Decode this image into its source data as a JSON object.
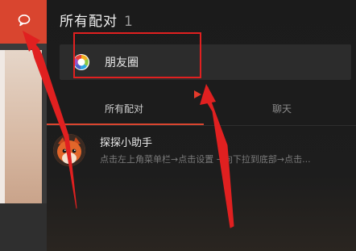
{
  "title": {
    "text": "所有配对",
    "count": "1"
  },
  "moments": {
    "label": "朋友圈",
    "icon": "moments-icon"
  },
  "tabs": [
    {
      "label": "所有配对",
      "active": true
    },
    {
      "label": "聊天",
      "active": false
    }
  ],
  "list": [
    {
      "title": "探探小助手",
      "subtitle": "点击左上角菜单栏→点击设置 →向下拉到底部→点击..."
    }
  ],
  "icons": {
    "left_top": "chat-bubble-icon",
    "avatar": "fox-avatar-icon"
  },
  "colors": {
    "accent": "#d9452f",
    "annotation_red": "#e02020",
    "panel_bg": "#1b1b1b",
    "bar_bg": "#2c2c2c"
  }
}
